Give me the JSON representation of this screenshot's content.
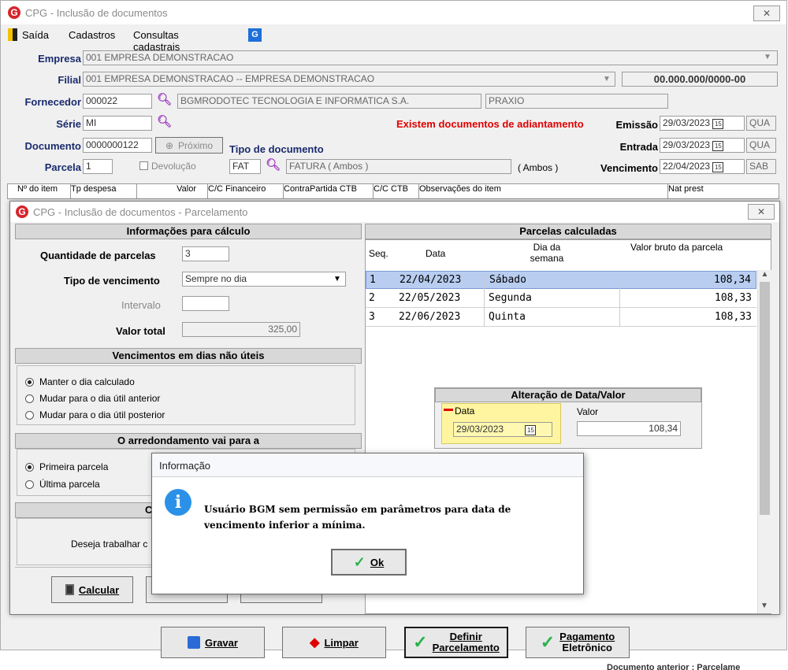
{
  "main_window": {
    "title": "CPG - Inclusão de documentos",
    "close": "✕"
  },
  "menu": [
    "Saída",
    "Cadastros",
    "Consultas cadastrais"
  ],
  "form": {
    "empresa_label": "Empresa",
    "empresa_value": "001 EMPRESA DEMONSTRACAO",
    "filial_label": "Filial",
    "filial_value": "001 EMPRESA DEMONSTRACAO -- EMPRESA DEMONSTRACAO",
    "cnpj": "00.000.000/0000-00",
    "fornecedor_label": "Fornecedor",
    "fornecedor_code": "000022",
    "fornecedor_name": "BGMRODOTEC TECNOLOGIA E INFORMATICA S.A.",
    "fornecedor_alias": "PRAXIO",
    "serie_label": "Série",
    "serie_value": "MI",
    "adiantamento_warning": "Existem documentos de adiantamento",
    "emissao_label": "Emissão",
    "emissao_date": "29/03/2023",
    "emissao_day": "QUA",
    "documento_label": "Documento",
    "documento_value": "0000000122",
    "proximo_label": "Próximo",
    "tipo_doc_label": "Tipo de documento",
    "entrada_label": "Entrada",
    "entrada_date": "29/03/2023",
    "entrada_day": "QUA",
    "parcela_label": "Parcela",
    "parcela_value": "1",
    "devolucao_label": "Devolução",
    "tipo_code": "FAT",
    "tipo_name": "FATURA ( Ambos )",
    "tipo_ambos": "( Ambos )",
    "vencimento_label": "Vencimento",
    "vencimento_date": "22/04/2023",
    "vencimento_day": "SAB"
  },
  "grid_headers": [
    "Nº do item",
    "Tp despesa",
    "Valor",
    "C/C Financeiro",
    "ContraPartida CTB",
    "C/C CTB",
    "Observações do item",
    "Nat prest"
  ],
  "bottom_buttons": {
    "gravar": "Gravar",
    "limpar": "Limpar",
    "definir_1": "Definir",
    "definir_2": "Parcelamento",
    "pagamento_1": "Pagamento",
    "pagamento_2": "Eletrônico"
  },
  "bottom_status": "Documento anterior : Parcelame",
  "parcel_window": {
    "title": "CPG - Inclusão de documentos - Parcelamento",
    "info_header": "Informações para cálculo",
    "qtd_label": "Quantidade de parcelas",
    "qtd_value": "3",
    "tipo_venc_label": "Tipo de vencimento",
    "tipo_venc_value": "Sempre no dia",
    "intervalo_label": "Intervalo",
    "valor_total_label": "Valor total",
    "valor_total_value": "325,00",
    "venc_header": "Vencimentos em dias não úteis",
    "venc_options": [
      "Manter o dia calculado",
      "Mudar para o dia útil anterior",
      "Mudar para o dia útil posterior"
    ],
    "arred_header": "O arredondamento vai para a",
    "arred_options": [
      "Primeira parcela",
      "Última parcela"
    ],
    "c_header": "C",
    "deseja_text": "Deseja trabalhar c",
    "calcular_label": "Calcular",
    "parcelas_header": "Parcelas calculadas",
    "col_seq": "Seq.",
    "col_data": "Data",
    "col_dia_1": "Dia da",
    "col_dia_2": "semana",
    "col_valor": "Valor bruto da parcela",
    "rows": [
      {
        "seq": "1",
        "data": "22/04/2023",
        "dia": "Sábado",
        "valor": "108,34"
      },
      {
        "seq": "2",
        "data": "22/05/2023",
        "dia": "Segunda",
        "valor": "108,33"
      },
      {
        "seq": "3",
        "data": "22/06/2023",
        "dia": "Quinta",
        "valor": "108,33"
      }
    ],
    "alter_header": "Alteração de Data/Valor",
    "alter_data_label": "Data",
    "alter_data_value": "29/03/2023",
    "alter_valor_label": "Valor",
    "alter_valor_value": "108,34"
  },
  "dialog": {
    "title": "Informação",
    "message_1": "Usuário BGM sem permissão em parâmetros para data de",
    "message_2": "vencimento inferior a mínima.",
    "ok_label": "Ok"
  }
}
